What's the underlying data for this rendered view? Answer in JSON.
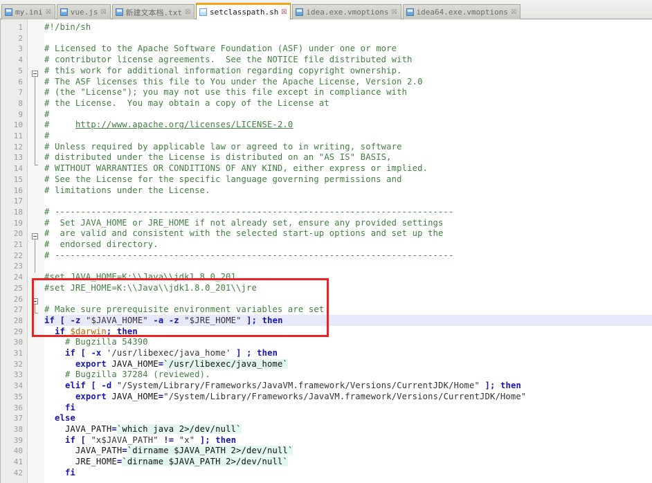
{
  "window": {
    "title": "setclasspath.sh",
    "accent_color": "#f5a317",
    "annotation_color": "#ee2222",
    "current_line_highlight": "#e8e8fb"
  },
  "tabbar": {
    "tabs": [
      {
        "label": "my.ini",
        "icon": "file-icon",
        "close": "☒",
        "active": false
      },
      {
        "label": "vue.js",
        "icon": "file-icon",
        "close": "☒",
        "active": false
      },
      {
        "label": "新建文本档.txt",
        "icon": "file-icon",
        "close": "☒",
        "active": false
      },
      {
        "label": "setclasspath.sh",
        "icon": "file-icon",
        "close": "☒",
        "active": true
      },
      {
        "label": "idea.exe.vmoptions",
        "icon": "file-icon",
        "close": "☒",
        "active": false
      },
      {
        "label": "idea64.exe.vmoptions",
        "icon": "file-icon",
        "close": "☒",
        "active": false
      }
    ]
  },
  "editor": {
    "line_numbers": [
      1,
      2,
      3,
      4,
      5,
      6,
      7,
      8,
      9,
      10,
      11,
      12,
      13,
      14,
      15,
      16,
      17,
      18,
      19,
      20,
      21,
      22,
      23,
      24,
      25,
      26,
      27,
      28,
      29,
      30,
      31,
      32,
      33,
      34,
      35,
      36,
      37,
      38,
      39,
      40,
      41,
      42
    ],
    "highlighted_line": 28,
    "annotated_lines": [
      23,
      24,
      25,
      26
    ],
    "lines": {
      "1": "#!/bin/sh",
      "2": "",
      "3": "# Licensed to the Apache Software Foundation (ASF) under one or more",
      "4": "# contributor license agreements.  See the NOTICE file distributed with",
      "5": "# this work for additional information regarding copyright ownership.",
      "6": "# The ASF licenses this file to You under the Apache License, Version 2.0",
      "7": "# (the \"License\"); you may not use this file except in compliance with",
      "8": "# the License.  You may obtain a copy of the License at",
      "9": "#",
      "10": "#     http://www.apache.org/licenses/LICENSE-2.0",
      "11": "#",
      "12": "# Unless required by applicable law or agreed to in writing, software",
      "13": "# distributed under the License is distributed on an \"AS IS\" BASIS,",
      "14": "# WITHOUT WARRANTIES OR CONDITIONS OF ANY KIND, either express or implied.",
      "15": "# See the License for the specific language governing permissions and",
      "16": "# limitations under the License.",
      "17": "",
      "18": "# -----------------------------------------------------------------------------",
      "19": "#  Set JAVA_HOME or JRE_HOME if not already set, ensure any provided settings",
      "20": "#  are valid and consistent with the selected start-up options and set up the",
      "21": "#  endorsed directory.",
      "22": "# -----------------------------------------------------------------------------",
      "23": "",
      "24": "#set JAVA_HOME=K:\\\\Java\\\\jdk1.8.0_201",
      "25": "#set JRE_HOME=K:\\\\Java\\\\jdk1.8.0_201\\\\jre",
      "26": "",
      "27": "# Make sure prerequisite environment variables are set",
      "28": "if [ -z \"$JAVA_HOME\" -a -z \"$JRE_HOME\" ]; then",
      "29": "  if $darwin; then",
      "30": "    # Bugzilla 54390",
      "31": "    if [ -x '/usr/libexec/java_home' ] ; then",
      "32": "      export JAVA_HOME=`/usr/libexec/java_home`",
      "33": "    # Bugzilla 37284 (reviewed).",
      "34": "    elif [ -d \"/System/Library/Frameworks/JavaVM.framework/Versions/CurrentJDK/Home\" ]; then",
      "35": "      export JAVA_HOME=\"/System/Library/Frameworks/JavaVM.framework/Versions/CurrentJDK/Home\"",
      "36": "    fi",
      "37": "  else",
      "38": "    JAVA_PATH=`which java 2>/dev/null`",
      "39": "    if [ \"x$JAVA_PATH\" != \"x\" ]; then",
      "40": "      JAVA_PATH=`dirname $JAVA_PATH 2>/dev/null`",
      "41": "      JRE_HOME=`dirname $JAVA_PATH 2>/dev/null`",
      "42": "    fi"
    }
  }
}
